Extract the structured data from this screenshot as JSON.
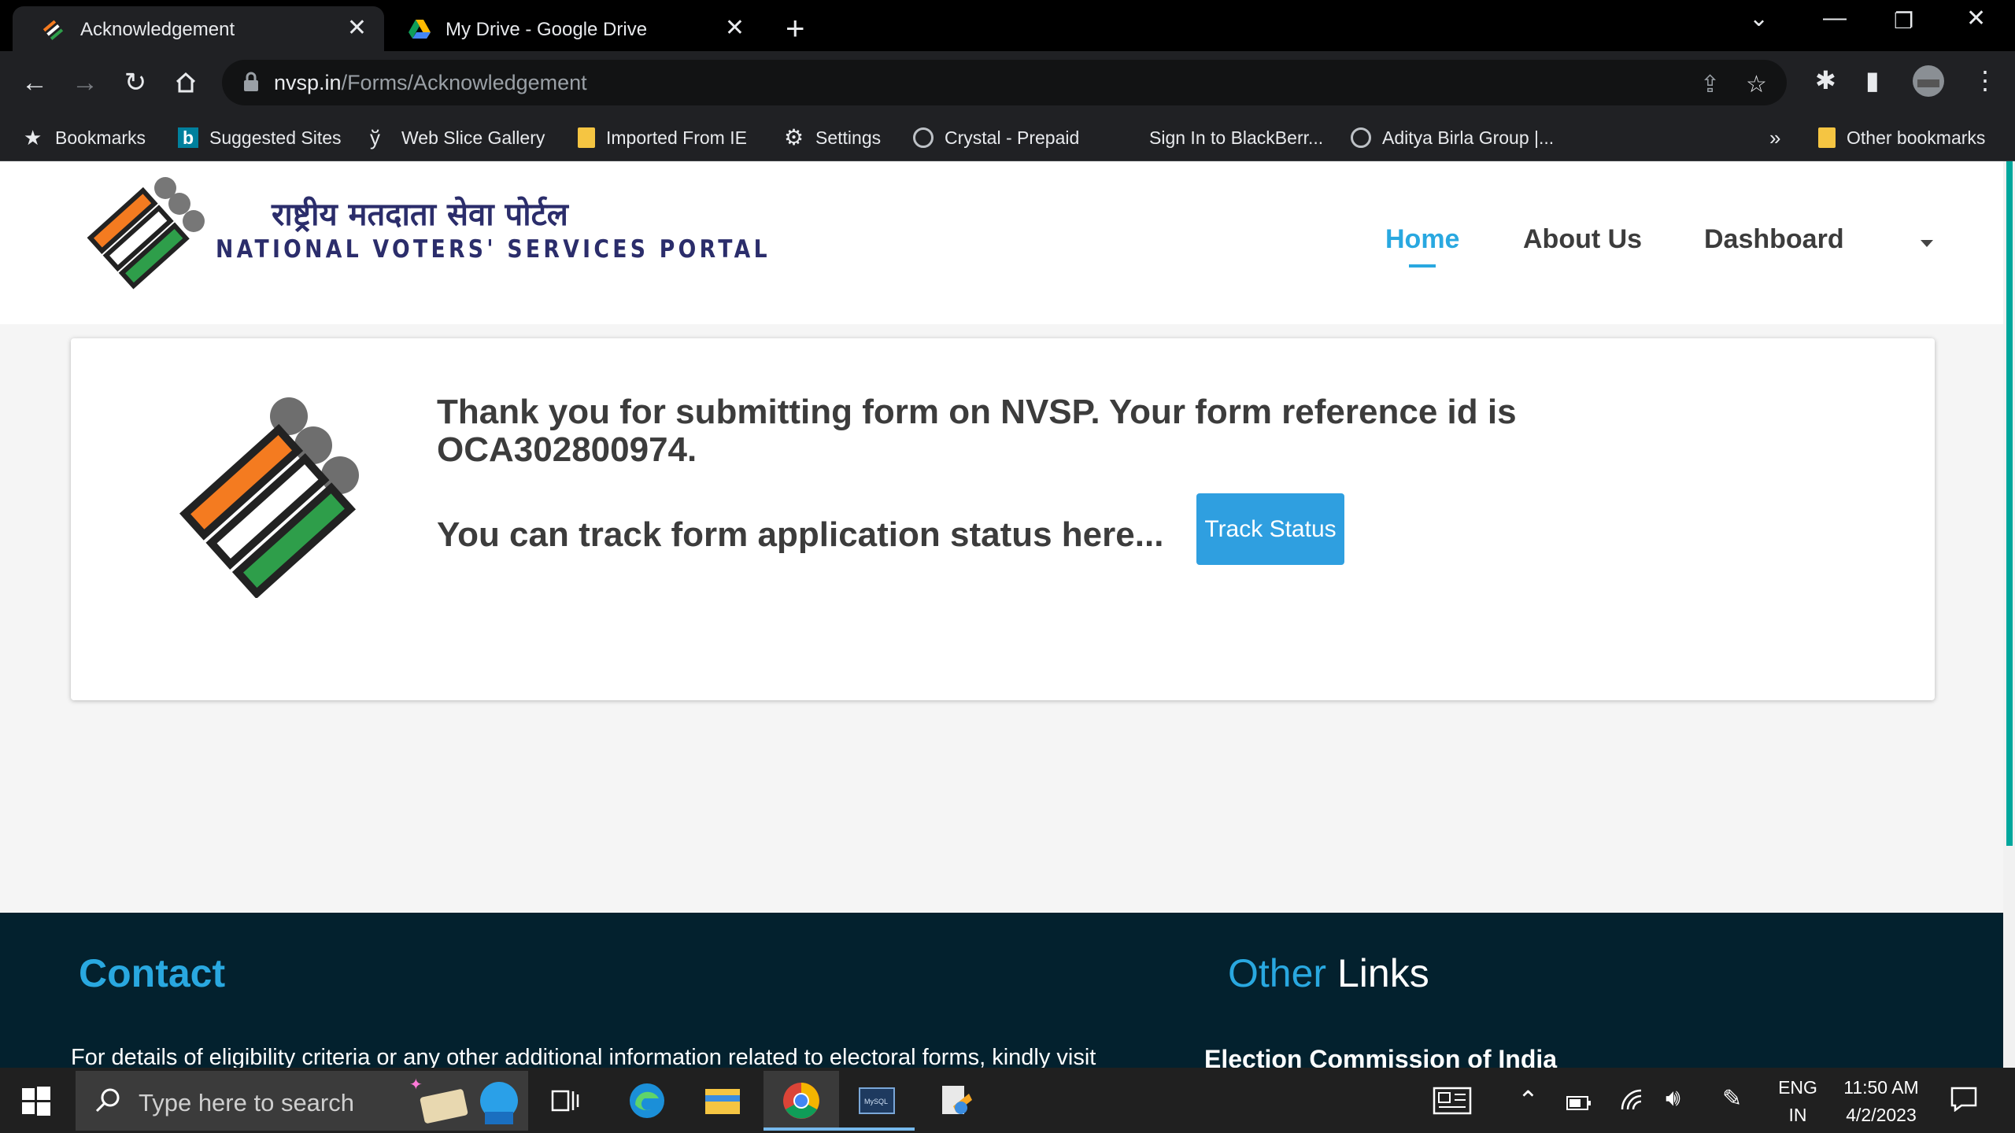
{
  "browser": {
    "tabs": [
      {
        "title": "Acknowledgement",
        "active": true
      },
      {
        "title": "My Drive - Google Drive",
        "active": false
      }
    ],
    "url_host": "nvsp.in",
    "url_path": "/Forms/Acknowledgement",
    "bookmarks": [
      {
        "label": "Bookmarks",
        "icon": "star-icon"
      },
      {
        "label": "Suggested Sites",
        "icon": "bing-icon"
      },
      {
        "label": "Web Slice Gallery",
        "icon": "web-slice-icon"
      },
      {
        "label": "Imported From IE",
        "icon": "folder-icon"
      },
      {
        "label": "Settings",
        "icon": "gear-icon"
      },
      {
        "label": "Crystal - Prepaid",
        "icon": "globe-icon"
      },
      {
        "label": "Sign In to BlackBerr...",
        "icon": "none"
      },
      {
        "label": "Aditya Birla Group |...",
        "icon": "globe-icon"
      }
    ],
    "overflow": "»",
    "other_bookmarks": "Other bookmarks"
  },
  "site": {
    "brand_hindi": "राष्ट्रीय मतदाता सेवा पोर्टल",
    "brand_english": "NATIONAL VOTERS' SERVICES PORTAL",
    "nav": {
      "home": "Home",
      "about": "About Us",
      "dashboard": "Dashboard"
    }
  },
  "ack": {
    "message": "Thank you for submitting form on NVSP. Your form reference id is OCA302800974.",
    "track_text": "You can track form application status here...",
    "track_button": "Track Status"
  },
  "footer": {
    "contact": "Contact",
    "other_a": "Other",
    "other_b": "Links",
    "text": "For details of eligibility criteria or any other additional information related to electoral forms, kindly visit",
    "eci": "Election Commission of India"
  },
  "taskbar": {
    "search_placeholder": "Type here to search",
    "lang_top": "ENG",
    "lang_bottom": "IN",
    "time": "11:50 AM",
    "date": "4/2/2023"
  },
  "colors": {
    "accent": "#29a8e0",
    "button": "#2f9fe0",
    "footer_bg": "#03212e",
    "brand_navy": "#2b2d6b"
  }
}
